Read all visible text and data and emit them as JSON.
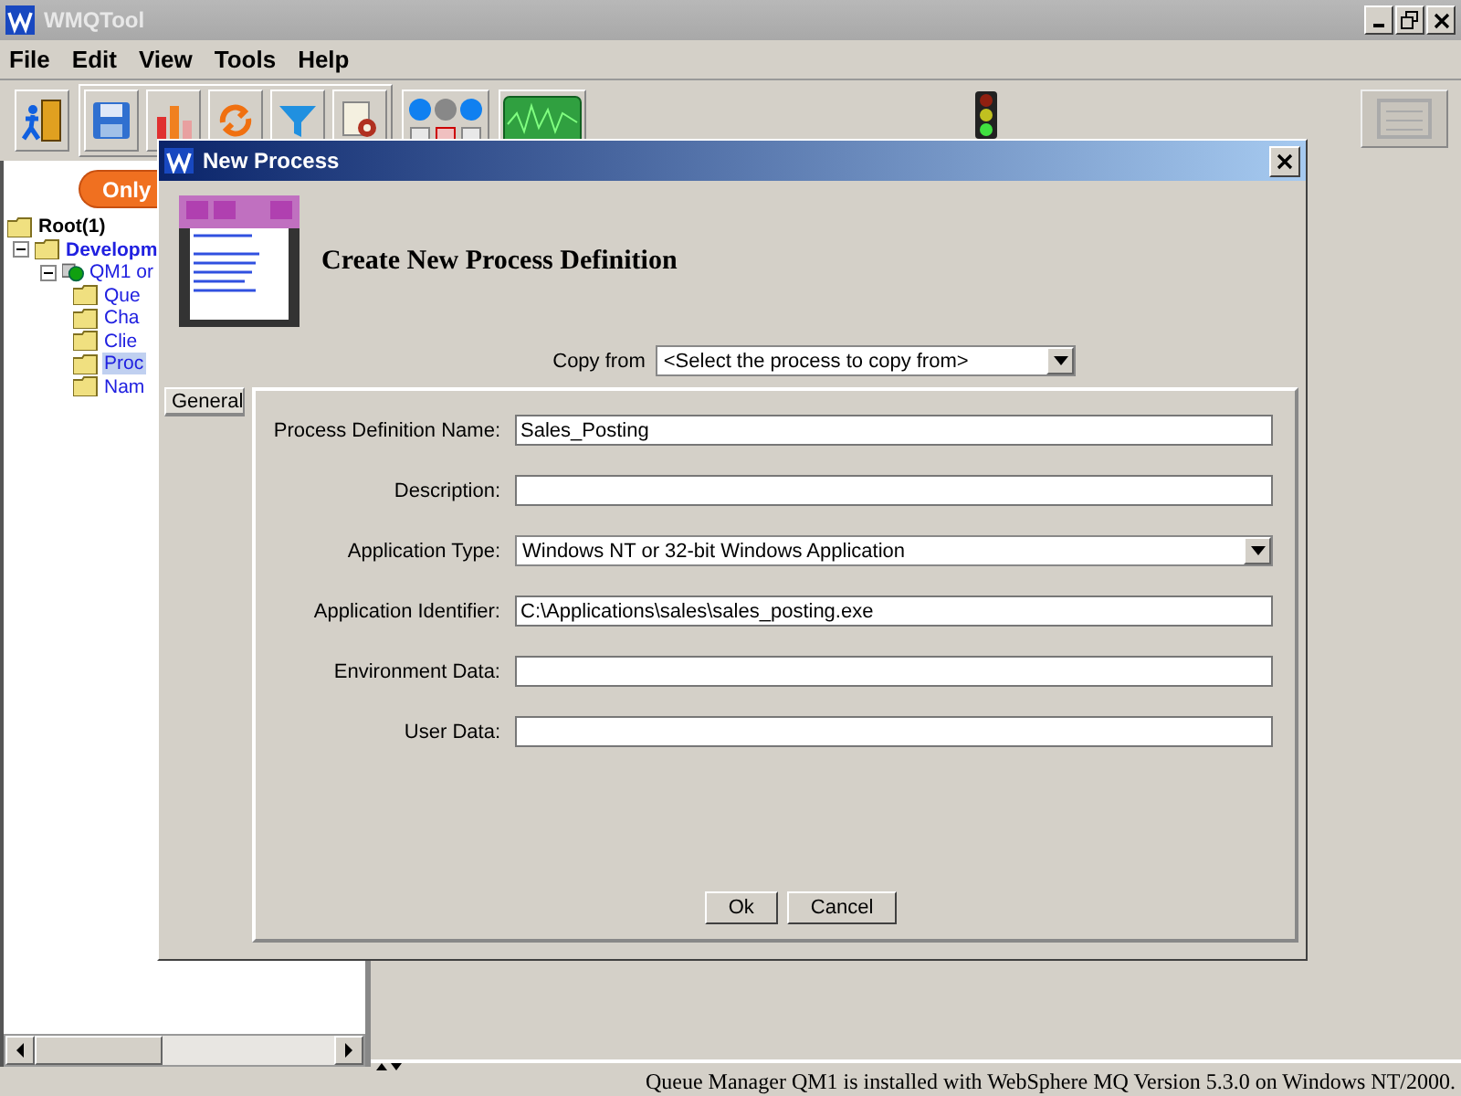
{
  "window": {
    "title": "WMQTool"
  },
  "menu": [
    "File",
    "Edit",
    "View",
    "Tools",
    "Help"
  ],
  "filter_button": {
    "label": "Only"
  },
  "tree": [
    {
      "label": "Root(1)",
      "kind": "folder",
      "selected": false,
      "children": [
        {
          "label": "Developm",
          "kind": "folder",
          "expanded": true,
          "selected": false,
          "children": [
            {
              "label": "QM1 or",
              "kind": "queue-manager",
              "expanded": true,
              "selected": false,
              "children": [
                {
                  "label": "Que",
                  "kind": "folder",
                  "selected": false
                },
                {
                  "label": "Cha",
                  "kind": "folder",
                  "selected": false
                },
                {
                  "label": "Clie",
                  "kind": "folder",
                  "selected": false
                },
                {
                  "label": "Proc",
                  "kind": "folder",
                  "selected": true
                },
                {
                  "label": "Nam",
                  "kind": "folder",
                  "selected": false
                }
              ]
            }
          ]
        }
      ]
    }
  ],
  "dialog": {
    "title": "New Process",
    "heading": "Create New Process Definition",
    "copy_from": {
      "label": "Copy from",
      "value": "<Select the process to copy from>"
    },
    "tabs": [
      {
        "label": "General",
        "selected": true
      }
    ],
    "fields": [
      {
        "label": "Process Definition Name:",
        "kind": "text",
        "value": "Sales_Posting"
      },
      {
        "label": "Description:",
        "kind": "text"
      },
      {
        "label": "Application Type:",
        "kind": "dropdown",
        "value": "Windows NT or 32-bit Windows Application"
      },
      {
        "label": "Application Identifier:",
        "kind": "text",
        "value": "C:\\Applications\\sales\\sales_posting.exe"
      },
      {
        "label": "Environment Data:",
        "kind": "text"
      },
      {
        "label": "User Data:",
        "kind": "text"
      }
    ],
    "buttons": [
      "Ok",
      "Cancel"
    ]
  },
  "status_bar": "Queue Manager QM1 is installed with WebSphere MQ Version 5.3.0 on Windows NT/2000."
}
